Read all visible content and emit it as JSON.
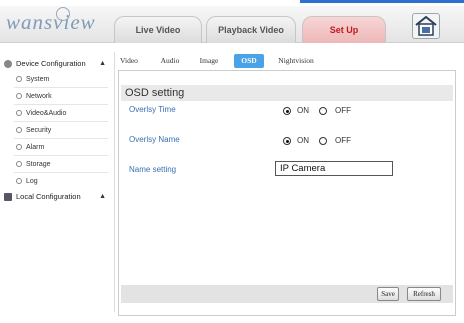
{
  "header": {
    "logo": "wansview",
    "tabs": [
      {
        "label": "Live Video"
      },
      {
        "label": "Playback Video"
      },
      {
        "label": "Set Up"
      }
    ]
  },
  "sidebar": {
    "device_config": {
      "label": "Device Configuration",
      "arrow": "▲"
    },
    "items": [
      {
        "label": "System"
      },
      {
        "label": "Network"
      },
      {
        "label": "Video&Audio"
      },
      {
        "label": "Security"
      },
      {
        "label": "Alarm"
      },
      {
        "label": "Storage"
      },
      {
        "label": "Log"
      }
    ],
    "local_config": {
      "label": "Local Configuration",
      "arrow": "▲"
    }
  },
  "subtabs": [
    {
      "label": "Video"
    },
    {
      "label": "Audio"
    },
    {
      "label": "Image"
    },
    {
      "label": "OSD"
    },
    {
      "label": "Nightvision"
    }
  ],
  "osd": {
    "title": "OSD setting",
    "overlay_time": {
      "label": "Overlsy Time",
      "on": "ON",
      "off": "OFF",
      "selected": "ON"
    },
    "overlay_name": {
      "label": "Overlsy Name",
      "on": "ON",
      "off": "OFF",
      "selected": "ON"
    },
    "name_setting": {
      "label": "Name setting",
      "value": "IP Camera"
    }
  },
  "buttons": {
    "save": "Save",
    "refresh": "Refresh"
  },
  "colors": {
    "active_subtab": "#49a3e6",
    "active_nav_tab_text": "#c01a1a",
    "field_label": "#3a6fb2"
  }
}
